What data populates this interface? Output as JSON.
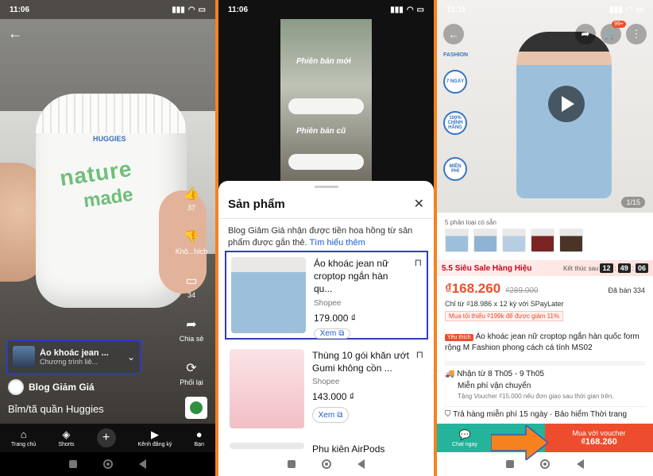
{
  "phone1": {
    "status_time": "11:06",
    "actions": [
      {
        "icon": "like-icon",
        "label": "37"
      },
      {
        "icon": "dislike-icon",
        "label": "Khô...hích"
      },
      {
        "icon": "comment-icon",
        "label": "34"
      },
      {
        "icon": "share-icon",
        "label": "Chia sẻ"
      },
      {
        "icon": "remix-icon",
        "label": "Phối lại"
      }
    ],
    "product_chip": {
      "title": "Áo khoác jean ...",
      "subtitle": "Chương trình liê..."
    },
    "channel_name": "Blog Giảm Giá",
    "caption": "Bỉm/tã quần Huggies",
    "diaper_brand": "HUGGIES",
    "diaper_text1": "nature",
    "diaper_text2": "made",
    "nav": [
      {
        "icon": "home-icon",
        "label": "Trang chủ"
      },
      {
        "icon": "shorts-icon",
        "label": "Shorts"
      },
      {
        "icon": "create-icon",
        "label": ""
      },
      {
        "icon": "subscriptions-icon",
        "label": "Kênh đăng ký"
      },
      {
        "icon": "you-icon",
        "label": "Bạn"
      }
    ]
  },
  "phone2": {
    "status_time": "11:06",
    "video_label_new": "Phiên bản mới",
    "video_label_old": "Phiên bản cũ",
    "sheet_title": "Sản phẩm",
    "note": "Blog Giảm Giá nhận được tiền hoa hồng từ sản phẩm được gắn thẻ.",
    "note_link": "Tìm hiểu thêm",
    "products": [
      {
        "title": "Áo khoác jean nữ croptop ngắn hàn qu...",
        "shop": "Shopee",
        "price": "179.000 ₫",
        "view": "Xem"
      },
      {
        "title": "Thùng 10 gói khăn ướt Gumi không cồn ...",
        "shop": "Shopee",
        "price": "143.000 ₫",
        "view": "Xem"
      },
      {
        "title": "Phụ kiện AirPods",
        "shop": "",
        "price": "",
        "view": ""
      }
    ]
  },
  "phone3": {
    "status_time": "11:11",
    "cart_count": "99+",
    "badges": [
      "7 NGÀY",
      "100% CHÍNH HÃNG",
      "MIỄN PHÍ"
    ],
    "fashion_label": "FASHION",
    "page_indicator": "1/15",
    "variants_label": "5 phân loại có sẵn",
    "sale_tag": "5.5",
    "sale_title": "Siêu Sale Hàng Hiệu",
    "countdown_label": "Kết thúc sau",
    "countdown": [
      "12",
      "49",
      "06"
    ],
    "price_now": "₫168.260",
    "price_old": "₫289.000",
    "sold": "Đã bán 334",
    "installment": "Chỉ từ ₫18.986 x 12 kỳ với SPayLater",
    "min_spend": "Mua tối thiểu ₫199k để được giảm 11%",
    "fav_tag": "Yêu thích",
    "product_title": "Áo khoác jean nữ croptop ngắn hàn quốc form rộng M Fashion phong cách cá tính MS02",
    "ship_line1": "Nhận từ 8 Th05 - 9 Th05",
    "ship_line2": "Miễn phí vận chuyển",
    "ship_sub": "Tặng Voucher ₫15.000 nếu đơn giao sau thời gian trên.",
    "returns": "Trả hàng miễn phí 15 ngày · Bảo hiểm Thời trang",
    "chat_label": "Chat ngay",
    "buy_label": "Mua với voucher",
    "buy_price": "₫168.260"
  }
}
